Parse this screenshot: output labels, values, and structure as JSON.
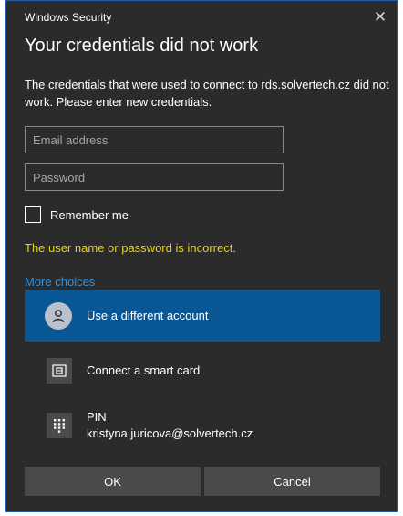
{
  "window": {
    "title": "Windows Security",
    "close_icon": "close-icon"
  },
  "heading": "Your credentials did not work",
  "message": "The credentials that were used to connect to rds.solvertech.cz did not work. Please enter new credentials.",
  "form": {
    "email_placeholder": "Email address",
    "email_value": "",
    "password_placeholder": "Password",
    "password_value": "",
    "remember_label": "Remember me",
    "remember_checked": false
  },
  "error": "The user name or password is incorrect.",
  "more_choices": {
    "label": "More choices",
    "items": [
      {
        "label": "Use a different account",
        "icon": "user-icon",
        "selected": true
      },
      {
        "label": "Connect a smart card",
        "icon": "smart-card-icon",
        "selected": false
      },
      {
        "label": "PIN",
        "sublabel": "kristyna.juricova@solvertech.cz",
        "icon": "pin-keypad-icon",
        "selected": false
      }
    ]
  },
  "buttons": {
    "ok": "OK",
    "cancel": "Cancel"
  },
  "colors": {
    "background": "#2b2b2b",
    "accent": "#0a5796",
    "link": "#3a8fd6",
    "error": "#e6d21f",
    "button": "#4a4a4a"
  }
}
